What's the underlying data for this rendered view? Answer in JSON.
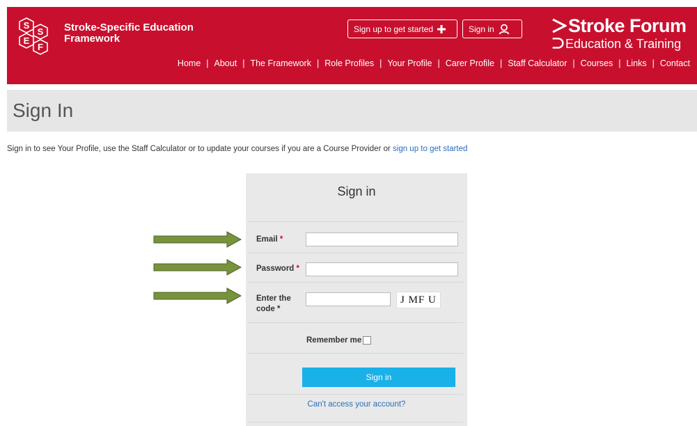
{
  "brand": {
    "logo_letters": [
      "S",
      "S",
      "E",
      "F"
    ],
    "title_line1": "Stroke-Specific Education",
    "title_line2": "Framework"
  },
  "header_buttons": {
    "signup_label": "Sign up to get started",
    "signin_label": "Sign in"
  },
  "partner_logo": {
    "line1": "Stroke Forum",
    "line2": "Education & Training"
  },
  "nav": {
    "items": [
      {
        "label": "Home"
      },
      {
        "label": "About"
      },
      {
        "label": "The Framework"
      },
      {
        "label": "Role Profiles"
      },
      {
        "label": "Your Profile"
      },
      {
        "label": "Carer Profile"
      },
      {
        "label": "Staff Calculator"
      },
      {
        "label": "Courses"
      },
      {
        "label": "Links"
      },
      {
        "label": "Contact"
      }
    ],
    "separator": "|"
  },
  "page": {
    "title": "Sign In",
    "intro_text": "Sign in to see Your Profile, use the Staff Calculator or to update your courses if you are a Course Provider or ",
    "intro_link": "sign up to get started"
  },
  "form": {
    "title": "Sign in",
    "email_label": "Email",
    "email_value": "",
    "password_label": "Password",
    "password_value": "",
    "code_label_line1": "Enter the",
    "code_label_line2": "code",
    "code_value": "",
    "captcha_text": "J MF U",
    "required_mark": "*",
    "remember_label": "Remember me",
    "remember_checked": false,
    "submit_label": "Sign in",
    "help_link": "Can't access your account?"
  },
  "colors": {
    "brand_red": "#c8102e",
    "accent_blue": "#1ab0e8",
    "link_blue": "#2a6ebb",
    "arrow_green": "#77933c"
  }
}
